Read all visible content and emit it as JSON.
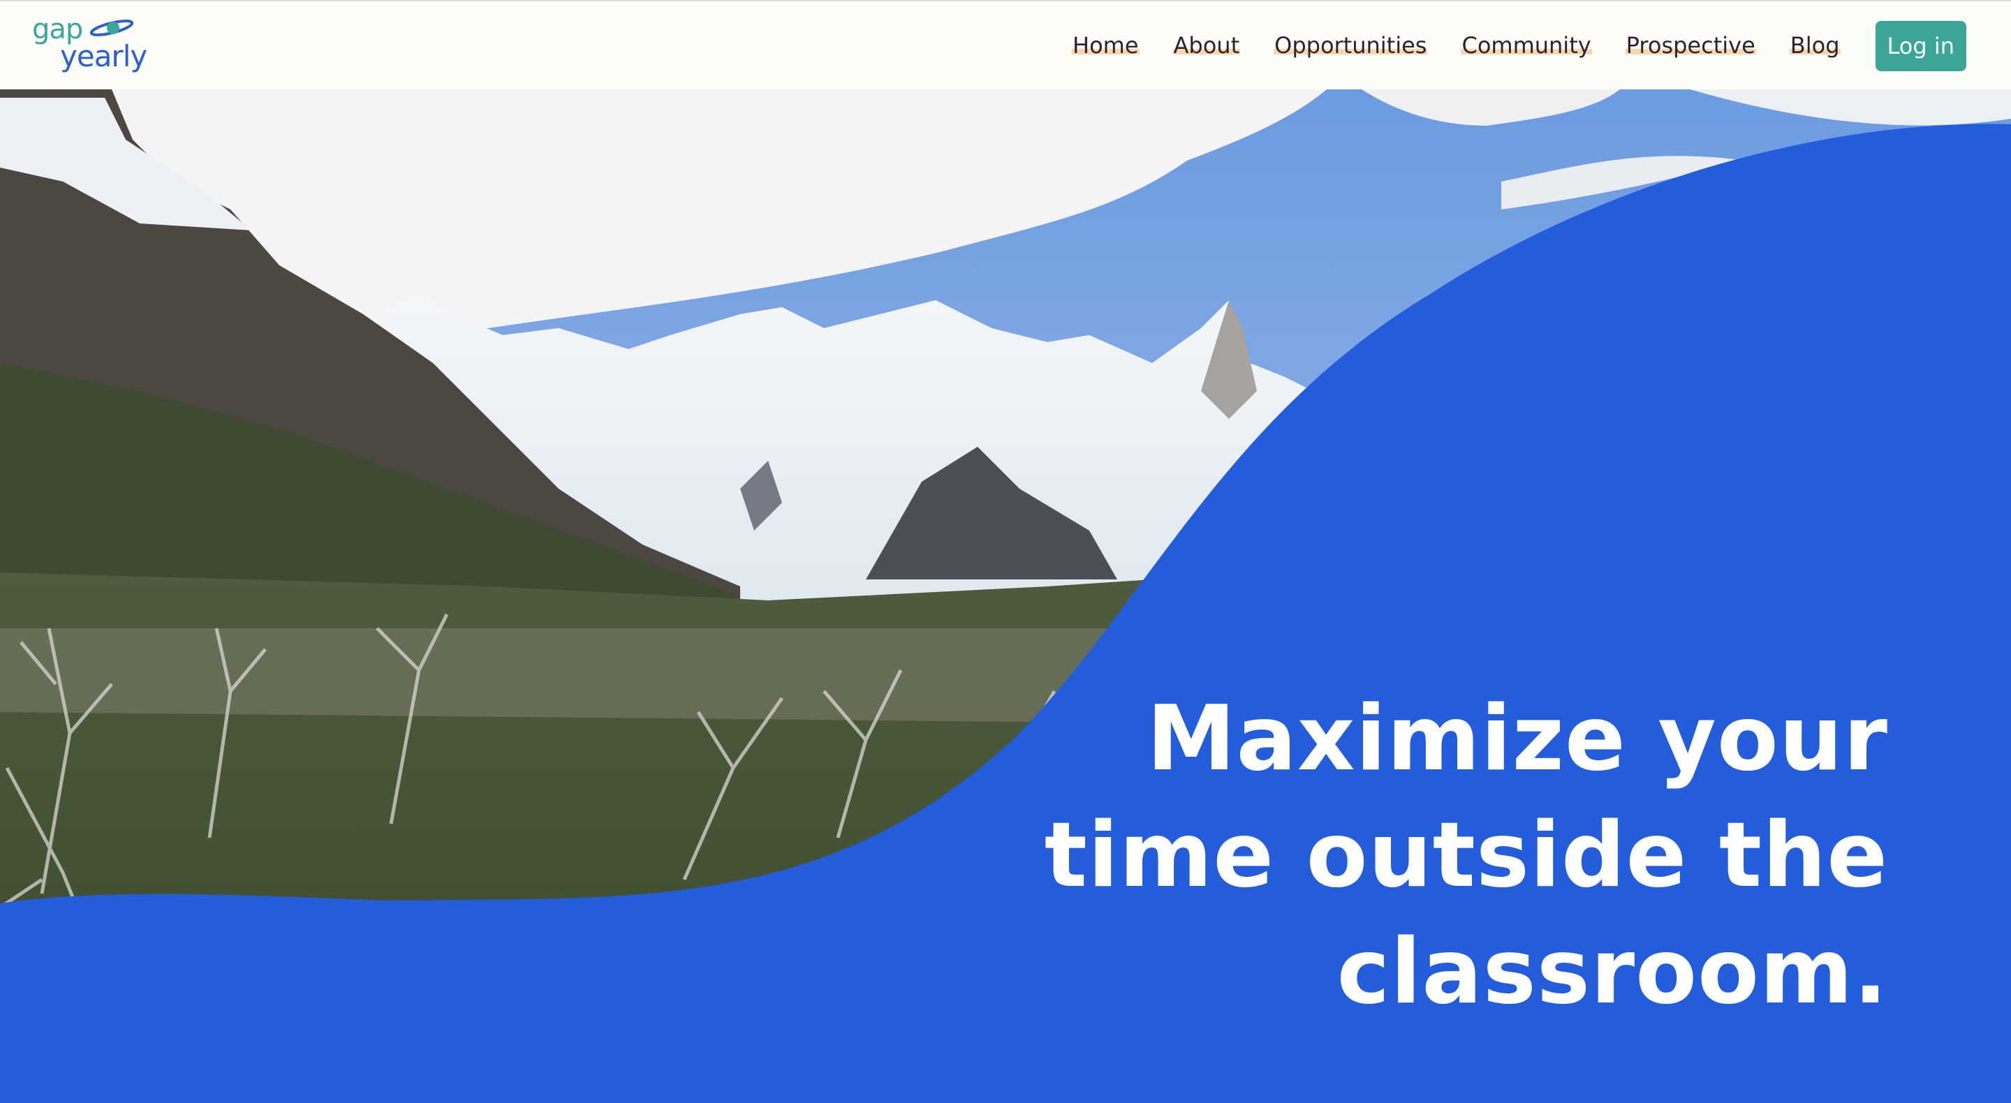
{
  "brand": {
    "logo_line1": "gap",
    "logo_line2": "yearly",
    "colors": {
      "teal": "#3ba6a0",
      "blue": "#2d60c8"
    }
  },
  "nav": {
    "links": [
      "Home",
      "About",
      "Opportunities",
      "Community",
      "Prospective",
      "Blog"
    ],
    "login_label": "Log in"
  },
  "hero": {
    "headline": "Maximize your time outside the classroom.",
    "accent_color": "#245ddb",
    "image_description": "snow-capped mountains and glacier above a valley of dead trees"
  }
}
